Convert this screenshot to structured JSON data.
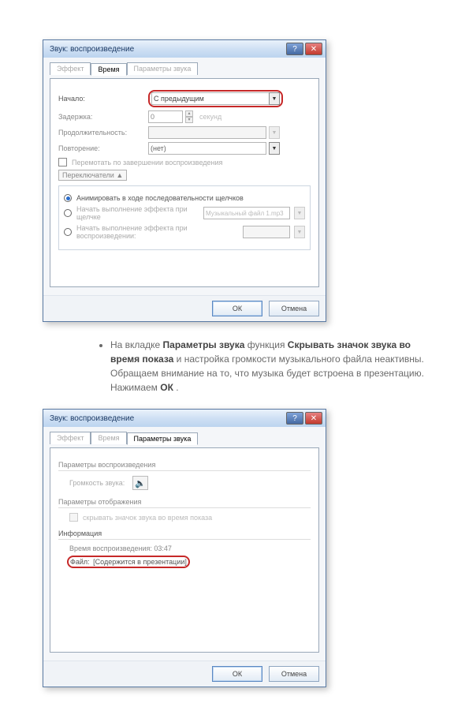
{
  "dialog1": {
    "title": "Звук: воспроизведение",
    "tabs": {
      "t1": "Эффект",
      "t2": "Время",
      "t3": "Параметры звука"
    },
    "labels": {
      "start": "Начало:",
      "delay": "Задержка:",
      "duration": "Продолжительность:",
      "repeat": "Повторение:",
      "seconds": "секунд",
      "rewind": "Перемотать по завершении воспроизведения",
      "triggers": "Переключатели ▲"
    },
    "start_value": "С предыдущим",
    "delay_value": "0",
    "repeat_value": "(нет)",
    "triggers_group": {
      "r1": "Анимировать в ходе последовательности щелчков",
      "r2": "Начать выполнение эффекта при щелчке",
      "r3": "Начать выполнение эффекта при воспроизведении:",
      "r2_option": "Музыкальный файл 1.mp3"
    },
    "buttons": {
      "ok": "ОК",
      "cancel": "Отмена"
    }
  },
  "explanation": {
    "prefix": "На вкладке ",
    "b1": "Параметры звука",
    "mid1": " функция ",
    "b2": "Скрывать значок звука во время показа",
    "mid2": " и настройка громкости музыкального файла неактивны. Обращаем внимание на то, что музыка будет встроена в презентацию. Нажимаем ",
    "b3": "ОК",
    "tail": "."
  },
  "dialog2": {
    "title": "Звук: воспроизведение",
    "tabs": {
      "t1": "Эффект",
      "t2": "Время",
      "t3": "Параметры звука"
    },
    "labels": {
      "play_params": "Параметры воспроизведения",
      "volume": "Громкость звука:",
      "display_params": "Параметры отображения",
      "hide_icon": "скрывать значок звука во время показа",
      "info": "Информация",
      "playtime": "Время воспроизведения:  03:47",
      "file_label": "Файл:",
      "file_value": "[Содержится в презентации]"
    },
    "buttons": {
      "ok": "ОК",
      "cancel": "Отмена"
    }
  }
}
